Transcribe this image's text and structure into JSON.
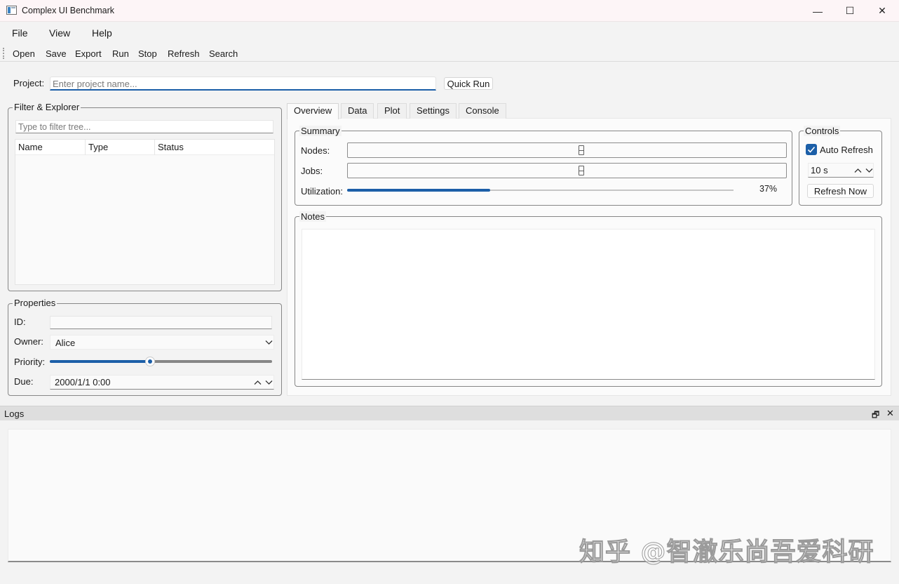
{
  "window": {
    "title": "Complex UI Benchmark",
    "minimize": "—",
    "maximize": "☐",
    "close": "✕"
  },
  "menu": [
    "File",
    "View",
    "Help"
  ],
  "toolbar": [
    "Open",
    "Save",
    "Export",
    "Run",
    "Stop",
    "Refresh",
    "Search"
  ],
  "project": {
    "label": "Project:",
    "placeholder": "Enter project name...",
    "quick_run": "Quick Run"
  },
  "explorer": {
    "title": "Filter & Explorer",
    "filter_placeholder": "Type to filter tree...",
    "columns": [
      "Name",
      "Type",
      "Status"
    ]
  },
  "properties": {
    "title": "Properties",
    "id_label": "ID:",
    "owner_label": "Owner:",
    "owner_value": "Alice",
    "priority_label": "Priority:",
    "priority_fraction": 0.45,
    "due_label": "Due:",
    "due_value": "2000/1/1 0:00"
  },
  "tabs": [
    "Overview",
    "Data",
    "Plot",
    "Settings",
    "Console"
  ],
  "summary": {
    "title": "Summary",
    "nodes_label": "Nodes:",
    "jobs_label": "Jobs:",
    "util_label": "Utilization:",
    "util_text": "37%",
    "util_fraction": 0.37
  },
  "controls": {
    "title": "Controls",
    "auto_refresh": "Auto Refresh",
    "auto_refresh_checked": true,
    "interval": "10 s",
    "refresh_now": "Refresh Now"
  },
  "notes": {
    "title": "Notes"
  },
  "logs": {
    "title": "Logs",
    "float_icon": "🗗",
    "close_icon": "✕"
  },
  "watermark": "知乎 @智澈乐尚吾爱科研",
  "colors": {
    "accent": "#1c5fa8"
  }
}
